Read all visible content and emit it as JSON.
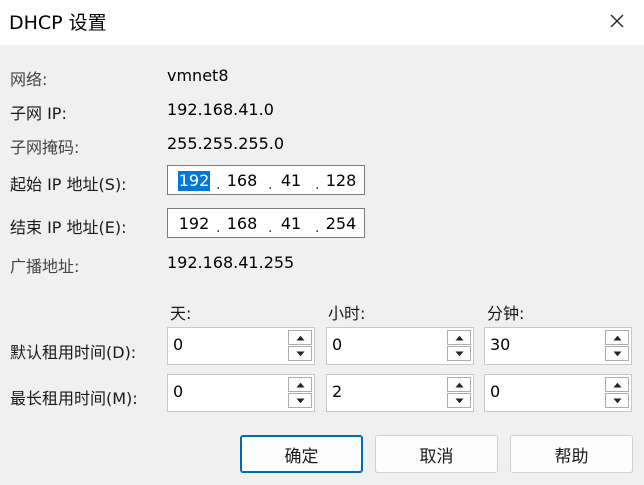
{
  "window": {
    "title": "DHCP 设置"
  },
  "network": {
    "label": "网络:",
    "value": "vmnet8"
  },
  "subnet_ip": {
    "label": "子网 IP:",
    "value": "192.168.41.0"
  },
  "subnet_mask": {
    "label": "子网掩码:",
    "value": "255.255.255.0"
  },
  "start_ip": {
    "label": "起始 IP 地址(S):",
    "octets": [
      "192",
      "168",
      "41",
      "128"
    ]
  },
  "end_ip": {
    "label": "结束 IP 地址(E):",
    "octets": [
      "192",
      "168",
      "41",
      "254"
    ]
  },
  "broadcast": {
    "label": "广播地址:",
    "value": "192.168.41.255"
  },
  "columns": {
    "days": "天:",
    "hours": "小时:",
    "minutes": "分钟:"
  },
  "default_lease": {
    "label": "默认租用时间(D):",
    "days": "0",
    "hours": "0",
    "minutes": "30"
  },
  "max_lease": {
    "label": "最长租用时间(M):",
    "days": "0",
    "hours": "2",
    "minutes": "0"
  },
  "buttons": {
    "ok": "确定",
    "cancel": "取消",
    "help": "帮助"
  },
  "colors": {
    "selection": "#0078d7",
    "default_button_border": "#0067c0",
    "dialog_bg": "#f0f0f0"
  },
  "icons": {
    "close": "close-icon",
    "spin_up": "chevron-up-icon",
    "spin_down": "chevron-down-icon"
  }
}
